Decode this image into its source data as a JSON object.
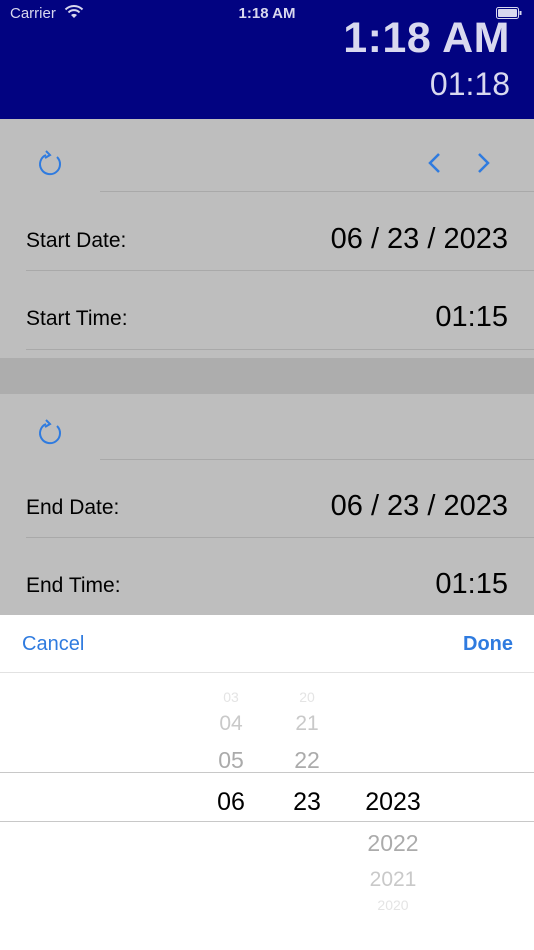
{
  "status_bar": {
    "carrier": "Carrier",
    "time": "1:18 AM"
  },
  "header": {
    "clock_main": "1:18 AM",
    "clock_24h": "01:18"
  },
  "start_section": {
    "date_label": "Start Date:",
    "date_value": "06 / 23 / 2023",
    "time_label": "Start Time:",
    "time_value": "01:15"
  },
  "end_section": {
    "date_label": "End Date:",
    "date_value": "06 / 23 / 2023",
    "time_label": "End Time:",
    "time_value": "01:15"
  },
  "picker": {
    "cancel_label": "Cancel",
    "done_label": "Done",
    "month": {
      "above": [
        "03",
        "04",
        "05"
      ],
      "selected": "06"
    },
    "day": {
      "above": [
        "20",
        "21",
        "22"
      ],
      "selected": "23"
    },
    "year": {
      "selected": "2023",
      "below": [
        "2022",
        "2021",
        "2020"
      ]
    }
  },
  "colors": {
    "header_bg": "#020381",
    "content_bg": "#bebebe",
    "accent": "#2f7bdf"
  }
}
